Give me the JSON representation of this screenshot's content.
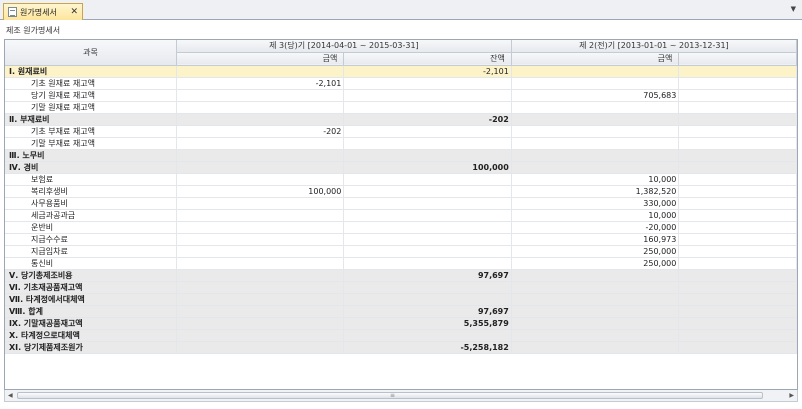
{
  "tab": {
    "label": "원가명세서",
    "close": "✕"
  },
  "menu_arrow": "▼",
  "subtitle": "제조 원가명세서",
  "columns": {
    "item": "과목",
    "current_period": "제 3(당)기 [2014-04-01 ~ 2015-03-31]",
    "prior_period": "제 2(전)기 [2013-01-01 ~ 2013-12-31]",
    "amount": "금액",
    "balance": "잔액"
  },
  "rows": [
    {
      "type": "sel",
      "name": "Ⅰ. 원재료비",
      "c_amt": "",
      "c_bal": "-2,101",
      "p_amt": "",
      "p_bal": ""
    },
    {
      "type": "item",
      "name": "기초 원재료 재고액",
      "c_amt": "-2,101",
      "c_bal": "",
      "p_amt": "",
      "p_bal": ""
    },
    {
      "type": "item",
      "name": "당기 원재료 재고액",
      "c_amt": "",
      "c_bal": "",
      "p_amt": "705,683",
      "p_bal": ""
    },
    {
      "type": "item",
      "name": "기말 원재료 재고액",
      "c_amt": "",
      "c_bal": "",
      "p_amt": "",
      "p_bal": ""
    },
    {
      "type": "cat",
      "name": "Ⅱ. 부재료비",
      "c_amt": "",
      "c_bal": "-202",
      "p_amt": "",
      "p_bal": ""
    },
    {
      "type": "item",
      "name": "기초 부재료 재고액",
      "c_amt": "-202",
      "c_bal": "",
      "p_amt": "",
      "p_bal": ""
    },
    {
      "type": "item",
      "name": "기말 부재료 재고액",
      "c_amt": "",
      "c_bal": "",
      "p_amt": "",
      "p_bal": ""
    },
    {
      "type": "cat",
      "name": "Ⅲ. 노무비",
      "c_amt": "",
      "c_bal": "",
      "p_amt": "",
      "p_bal": ""
    },
    {
      "type": "cat",
      "name": "Ⅳ. 경비",
      "c_amt": "",
      "c_bal": "100,000",
      "p_amt": "",
      "p_bal": ""
    },
    {
      "type": "item",
      "name": "보험료",
      "c_amt": "",
      "c_bal": "",
      "p_amt": "10,000",
      "p_bal": ""
    },
    {
      "type": "item",
      "name": "복리후생비",
      "c_amt": "100,000",
      "c_bal": "",
      "p_amt": "1,382,520",
      "p_bal": ""
    },
    {
      "type": "item",
      "name": "사무용품비",
      "c_amt": "",
      "c_bal": "",
      "p_amt": "330,000",
      "p_bal": ""
    },
    {
      "type": "item",
      "name": "세금과공과금",
      "c_amt": "",
      "c_bal": "",
      "p_amt": "10,000",
      "p_bal": ""
    },
    {
      "type": "item",
      "name": "운반비",
      "c_amt": "",
      "c_bal": "",
      "p_amt": "-20,000",
      "p_bal": ""
    },
    {
      "type": "item",
      "name": "지급수수료",
      "c_amt": "",
      "c_bal": "",
      "p_amt": "160,973",
      "p_bal": ""
    },
    {
      "type": "item",
      "name": "지급임차료",
      "c_amt": "",
      "c_bal": "",
      "p_amt": "250,000",
      "p_bal": ""
    },
    {
      "type": "item",
      "name": "통신비",
      "c_amt": "",
      "c_bal": "",
      "p_amt": "250,000",
      "p_bal": ""
    },
    {
      "type": "cat",
      "name": "Ⅴ. 당기총제조비용",
      "c_amt": "",
      "c_bal": "97,697",
      "p_amt": "",
      "p_bal": ""
    },
    {
      "type": "cat",
      "name": "Ⅵ. 기초재공품재고액",
      "c_amt": "",
      "c_bal": "",
      "p_amt": "",
      "p_bal": ""
    },
    {
      "type": "cat",
      "name": "Ⅶ. 타계정에서대체액",
      "c_amt": "",
      "c_bal": "",
      "p_amt": "",
      "p_bal": ""
    },
    {
      "type": "cat",
      "name": "Ⅷ. 합계",
      "c_amt": "",
      "c_bal": "97,697",
      "p_amt": "",
      "p_bal": ""
    },
    {
      "type": "cat",
      "name": "Ⅸ. 기말재공품재고액",
      "c_amt": "",
      "c_bal": "5,355,879",
      "p_amt": "",
      "p_bal": ""
    },
    {
      "type": "cat",
      "name": "Ⅹ. 타계정으로대체액",
      "c_amt": "",
      "c_bal": "",
      "p_amt": "",
      "p_bal": ""
    },
    {
      "type": "cat",
      "name": "ⅩⅠ. 당기제품제조원가",
      "c_amt": "",
      "c_bal": "-5,258,182",
      "p_amt": "",
      "p_bal": ""
    }
  ],
  "scrollbar": {
    "left_arrow": "◀",
    "right_arrow": "▶",
    "grip": "≡"
  }
}
